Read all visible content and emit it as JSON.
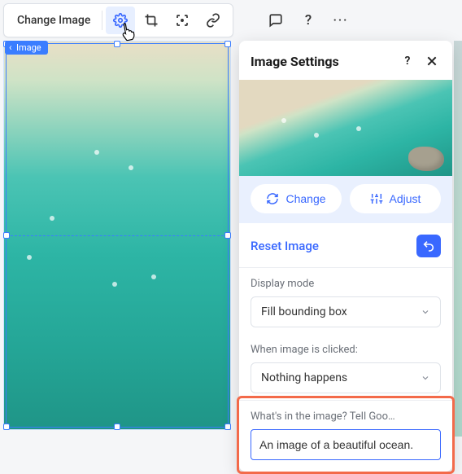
{
  "toolbar": {
    "change_image": "Change Image"
  },
  "element_tag": "Image",
  "panel": {
    "title": "Image Settings",
    "change_btn": "Change",
    "adjust_btn": "Adjust",
    "reset_label": "Reset Image",
    "display_mode": {
      "label": "Display mode",
      "value": "Fill bounding box"
    },
    "click_action": {
      "label": "When image is clicked:",
      "value": "Nothing happens"
    },
    "alt_text": {
      "label": "What's in the image? Tell Goo…",
      "value": "An image of a beautiful ocean."
    }
  }
}
